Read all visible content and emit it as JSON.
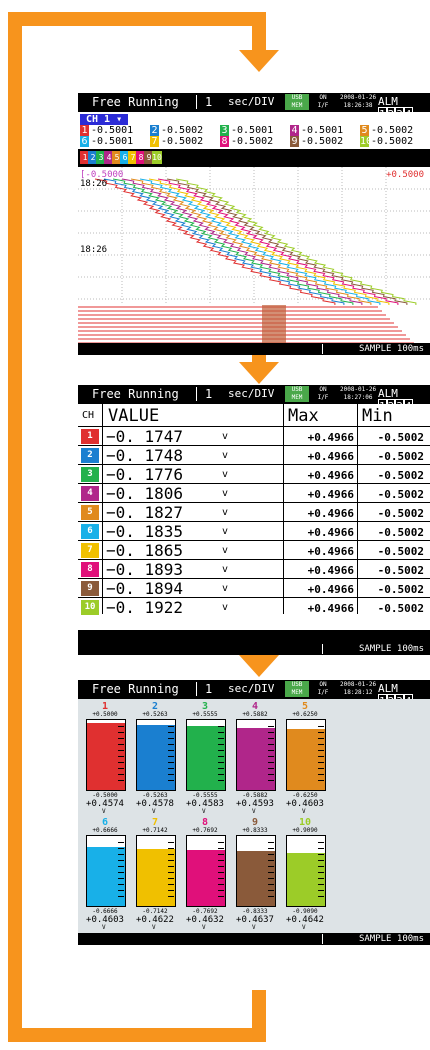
{
  "header": {
    "mode": "Free Running",
    "page": "1",
    "timebase": "sec/DIV",
    "usb_top": "USB",
    "usb_bottom": "MEM",
    "lan_top": "ON",
    "lan_bottom": "I/F",
    "alarm": "ALM",
    "alarm_ports": [
      "1",
      "2",
      "3",
      "4"
    ]
  },
  "footer": {
    "sample": "SAMPLE  100ms"
  },
  "colors": [
    "#e03030",
    "#1a7fd0",
    "#22b14c",
    "#b0268a",
    "#e08a1e",
    "#18b0e8",
    "#f0c000",
    "#e0107a",
    "#8a5a3a",
    "#9ccc28"
  ],
  "screen1": {
    "datetime_date": "2008-01-26",
    "datetime_time": "18:26:38",
    "channel_tag": "CH  1  ▾",
    "readings": [
      {
        "ch": "1",
        "value": "-0.5001"
      },
      {
        "ch": "2",
        "value": "-0.5002"
      },
      {
        "ch": "3",
        "value": "-0.5001"
      },
      {
        "ch": "4",
        "value": "-0.5001"
      },
      {
        "ch": "5",
        "value": "-0.5002"
      },
      {
        "ch": "6",
        "value": "-0.5001"
      },
      {
        "ch": "7",
        "value": "-0.5002"
      },
      {
        "ch": "8",
        "value": "-0.5002"
      },
      {
        "ch": "9",
        "value": "-0.5002"
      },
      {
        "ch": "10",
        "value": "-0.5002"
      }
    ],
    "scale_left": "[-0.5000",
    "scale_right": "+0.5000",
    "time_top": "18:26",
    "time_mid": "18:26"
  },
  "screen2": {
    "datetime_date": "2008-01-26",
    "datetime_time": "18:27:06",
    "col_ch": "CH",
    "col_value": "VALUE",
    "col_max": "Max",
    "col_min": "Min",
    "rows": [
      {
        "ch": "1",
        "value": "−0. 1747",
        "unit": "v",
        "max": "+0.4966",
        "min": "-0.5002"
      },
      {
        "ch": "2",
        "value": "−0. 1748",
        "unit": "v",
        "max": "+0.4966",
        "min": "-0.5002"
      },
      {
        "ch": "3",
        "value": "−0. 1776",
        "unit": "v",
        "max": "+0.4966",
        "min": "-0.5002"
      },
      {
        "ch": "4",
        "value": "−0. 1806",
        "unit": "v",
        "max": "+0.4966",
        "min": "-0.5002"
      },
      {
        "ch": "5",
        "value": "−0. 1827",
        "unit": "v",
        "max": "+0.4966",
        "min": "-0.5002"
      },
      {
        "ch": "6",
        "value": "−0. 1835",
        "unit": "v",
        "max": "+0.4966",
        "min": "-0.5002"
      },
      {
        "ch": "7",
        "value": "−0. 1865",
        "unit": "v",
        "max": "+0.4966",
        "min": "-0.5002"
      },
      {
        "ch": "8",
        "value": "−0. 1893",
        "unit": "v",
        "max": "+0.4966",
        "min": "-0.5002"
      },
      {
        "ch": "9",
        "value": "−0. 1894",
        "unit": "v",
        "max": "+0.4966",
        "min": "-0.5002"
      },
      {
        "ch": "10",
        "value": "−0. 1922",
        "unit": "v",
        "max": "+0.4966",
        "min": "-0.5002"
      }
    ]
  },
  "screen3": {
    "datetime_date": "2008-01-26",
    "datetime_time": "18:28:12",
    "meters": [
      {
        "ch": "1",
        "top": "+0.5000",
        "bottom": "-0.5000",
        "value": "+0.4574",
        "unit": "V",
        "level": 0.96
      },
      {
        "ch": "2",
        "top": "+0.5263",
        "bottom": "-0.5263",
        "value": "+0.4578",
        "unit": "V",
        "level": 0.93
      },
      {
        "ch": "3",
        "top": "+0.5555",
        "bottom": "-0.5555",
        "value": "+0.4583",
        "unit": "V",
        "level": 0.91
      },
      {
        "ch": "4",
        "top": "+0.5882",
        "bottom": "-0.5882",
        "value": "+0.4593",
        "unit": "V",
        "level": 0.89
      },
      {
        "ch": "5",
        "top": "+0.6250",
        "bottom": "-0.6250",
        "value": "+0.4603",
        "unit": "V",
        "level": 0.87
      },
      {
        "ch": "6",
        "top": "+0.6666",
        "bottom": "-0.6666",
        "value": "+0.4603",
        "unit": "V",
        "level": 0.85
      },
      {
        "ch": "7",
        "top": "+0.7142",
        "bottom": "-0.7142",
        "value": "+0.4622",
        "unit": "V",
        "level": 0.82
      },
      {
        "ch": "8",
        "top": "+0.7692",
        "bottom": "-0.7692",
        "value": "+0.4632",
        "unit": "V",
        "level": 0.8
      },
      {
        "ch": "9",
        "top": "+0.8333",
        "bottom": "-0.8333",
        "value": "+0.4637",
        "unit": "V",
        "level": 0.78
      },
      {
        "ch": "10",
        "top": "+0.9090",
        "bottom": "-0.9090",
        "value": "+0.4642",
        "unit": "V",
        "level": 0.76
      }
    ]
  }
}
